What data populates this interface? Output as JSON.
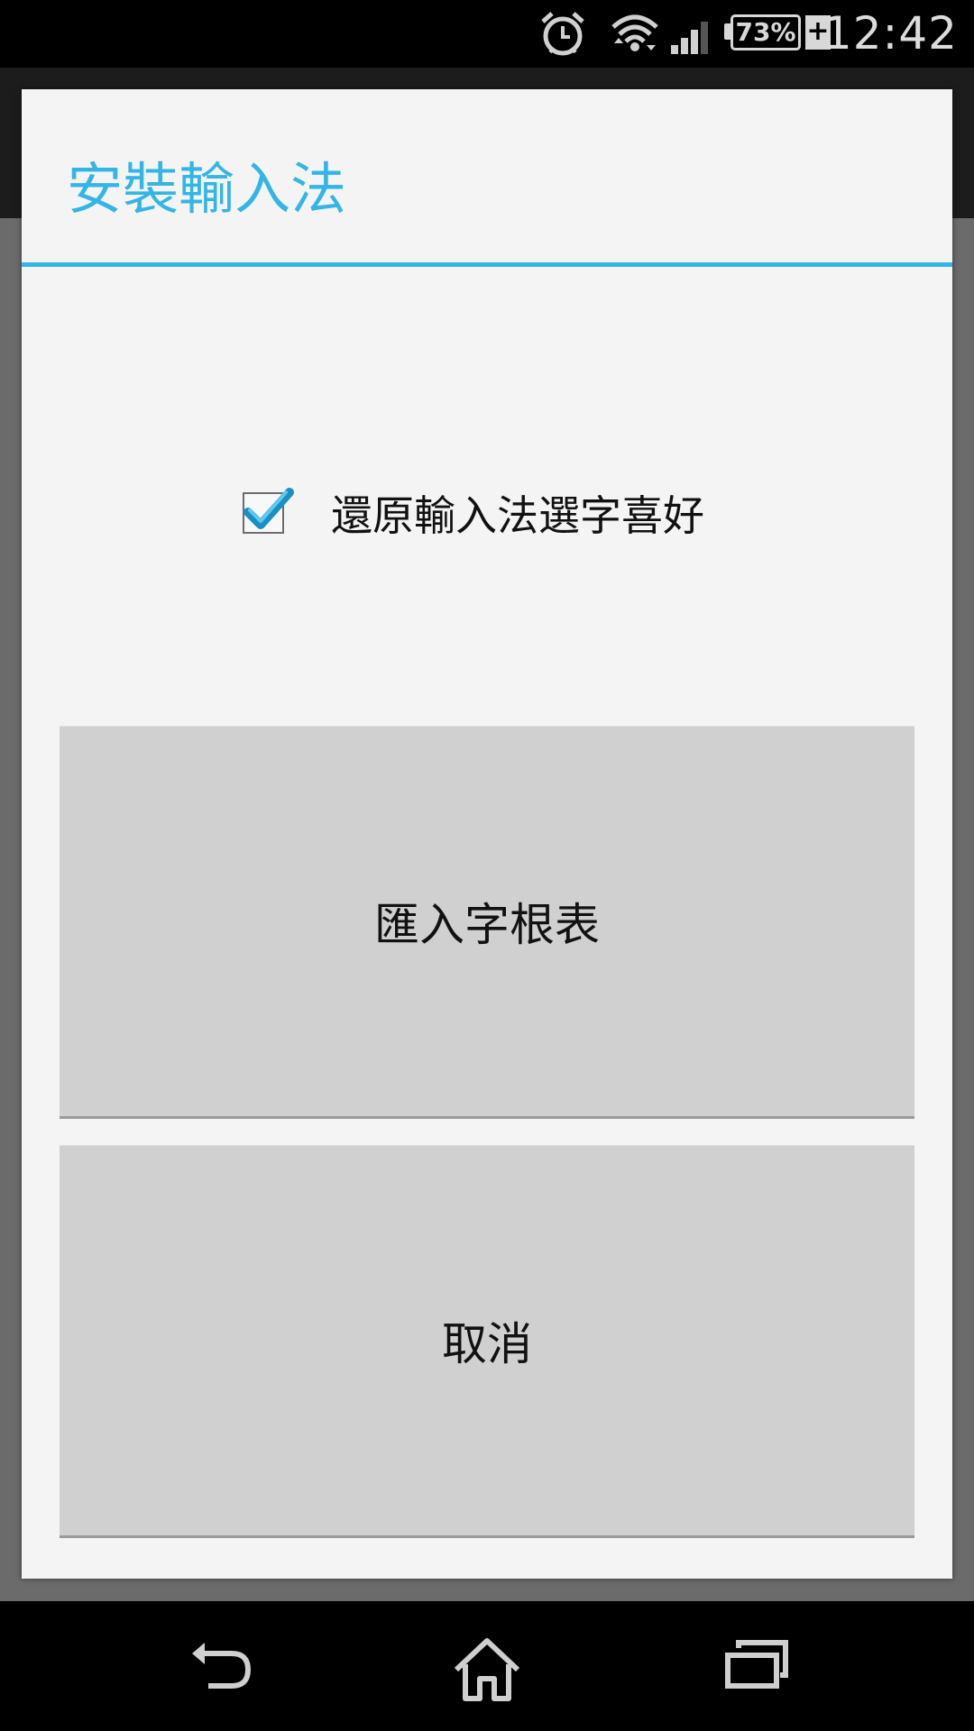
{
  "status_bar": {
    "time": "12:42",
    "battery_percent": "73%",
    "charging_symbol": "+",
    "icons": [
      "alarm-clock-icon",
      "wifi-icon",
      "signal-icon",
      "battery-icon"
    ]
  },
  "dialog": {
    "title": "安裝輸入法",
    "checkbox": {
      "label": "還原輸入法選字喜好",
      "checked": true
    },
    "buttons": {
      "import_label": "匯入字根表",
      "cancel_label": "取消"
    }
  },
  "nav_bar": {
    "icons": [
      "back-icon",
      "home-icon",
      "recents-icon"
    ]
  },
  "colors": {
    "accent": "#33b5e5",
    "button_bg": "#d0d0d0",
    "dialog_bg": "#f4f4f4"
  }
}
